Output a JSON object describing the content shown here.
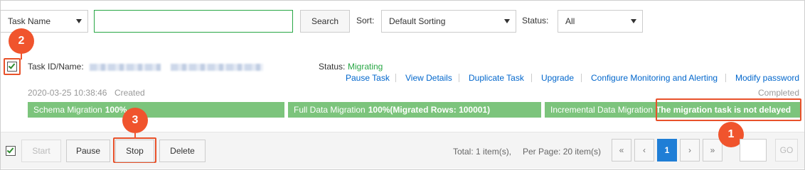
{
  "filters": {
    "field_select": "Task Name",
    "search_value": "",
    "search_button": "Search",
    "sort_label": "Sort:",
    "sort_select": "Default Sorting",
    "status_label": "Status:",
    "status_select": "All"
  },
  "task": {
    "id_label": "Task ID/Name:",
    "status_label": "Status:",
    "status_value": "Migrating",
    "actions": [
      "Pause Task",
      "View Details",
      "Duplicate Task",
      "Upgrade",
      "Configure Monitoring and Alerting",
      "Modify password"
    ],
    "created_time": "2020-03-25 10:38:46",
    "created_label": "Created",
    "completed_label": "Completed",
    "stages": [
      {
        "name": "Schema Migration",
        "detail": "100%"
      },
      {
        "name": "Full Data Migration",
        "detail": "100%(Migrated Rows: 100001)"
      },
      {
        "name": "Incremental Data Migration",
        "detail": "The migration task is not delayed"
      }
    ]
  },
  "footer": {
    "start": "Start",
    "pause": "Pause",
    "stop": "Stop",
    "delete": "Delete",
    "total_text": "Total: 1 item(s),",
    "per_page_text": "Per Page: 20 item(s)",
    "pager": {
      "first": "«",
      "prev": "‹",
      "current": "1",
      "next": "›",
      "last": "»"
    },
    "page_input": "",
    "go": "GO"
  },
  "callouts": [
    "1",
    "2",
    "3"
  ],
  "colors": {
    "accent": "#1f7ed6",
    "status_green": "#28a745",
    "progress_green": "#7cc47c",
    "callout": "#f0542d",
    "link": "#0066cc"
  }
}
